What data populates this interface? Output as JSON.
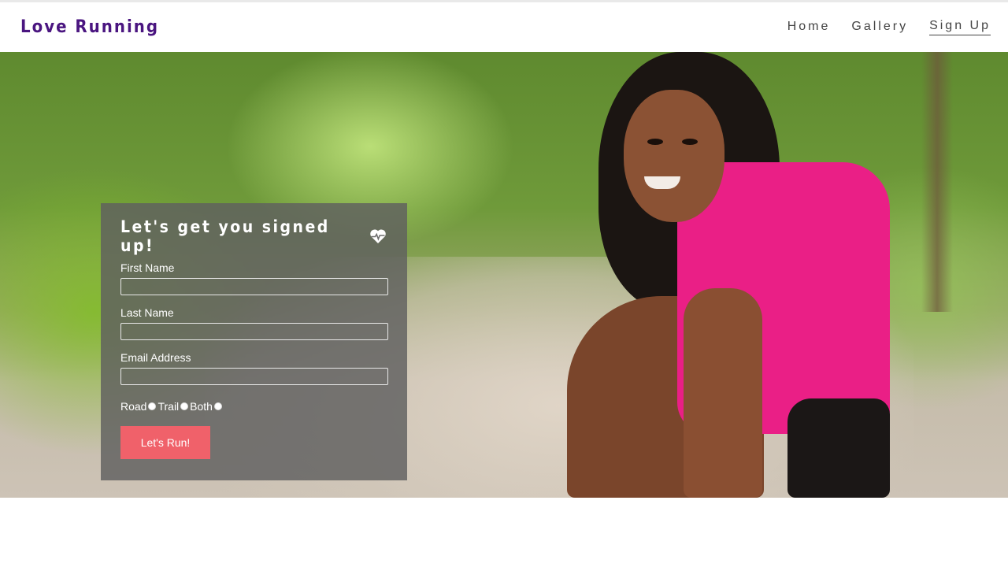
{
  "brand": "Love Running",
  "nav": {
    "items": [
      {
        "label": "Home",
        "active": false
      },
      {
        "label": "Gallery",
        "active": false
      },
      {
        "label": "Sign Up",
        "active": true
      }
    ]
  },
  "form": {
    "title": "Let's get you signed up!",
    "title_icon": "heartbeat-icon",
    "fields": [
      {
        "label": "First Name",
        "value": ""
      },
      {
        "label": "Last Name",
        "value": ""
      },
      {
        "label": "Email Address",
        "value": ""
      }
    ],
    "run_type_options": [
      "Road",
      "Trail",
      "Both"
    ],
    "submit_label": "Let's Run!"
  },
  "colors": {
    "brand": "#4a1580",
    "button": "#f0616a",
    "panel": "rgba(95,95,95,0.82)"
  }
}
